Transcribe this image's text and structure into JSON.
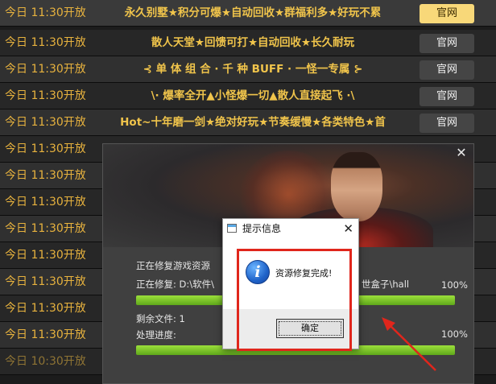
{
  "servers": [
    {
      "time": "今日 11:30开放",
      "desc": "永久别墅★积分可爆★自动回收★群福利多★好玩不累",
      "site": "官网"
    },
    {
      "time": "今日 11:30开放",
      "desc": "散人天堂★回馈可打★自动回收★长久耐玩",
      "site": "官网"
    },
    {
      "time": "今日 11:30开放",
      "desc": "⊰ 单 体 组 合 · 千 种 BUFF · 一怪一专属 ⊱",
      "site": "官网"
    },
    {
      "time": "今日 11:30开放",
      "desc": "\\· 爆率全开▲小怪爆一切▲散人直接起飞 ·\\",
      "site": "官网"
    },
    {
      "time": "今日 11:30开放",
      "desc": "Hot~十年磨一剑★绝对好玩★节奏缓慢★各类特色★首",
      "site": "官网"
    },
    {
      "time": "今日 11:30开放",
      "desc": "",
      "site": ""
    },
    {
      "time": "今日 11:30开放",
      "desc": "",
      "site": ""
    },
    {
      "time": "今日 11:30开放",
      "desc": "",
      "site": ""
    },
    {
      "time": "今日 11:30开放",
      "desc": "",
      "site": ""
    },
    {
      "time": "今日 11:30开放",
      "desc": "",
      "site": ""
    },
    {
      "time": "今日 11:30开放",
      "desc": "",
      "site": ""
    },
    {
      "time": "今日 11:30开放",
      "desc": "",
      "site": ""
    },
    {
      "time": "今日 11:30开放",
      "desc": "",
      "site": ""
    },
    {
      "time": "今日 10:30开放",
      "desc": "",
      "site": ""
    }
  ],
  "repair_window": {
    "close": "✕",
    "status": "正在修复游戏资源",
    "repairing_label": "正在修复: D:\\软件\\",
    "path_tail": "世盒子\\hall",
    "progress1_text": "100%",
    "progress1_value": 1.0,
    "remaining_label": "剩余文件: 1",
    "process_label": "处理进度:",
    "progress2_text": "100%",
    "progress2_value": 1.0
  },
  "dialog": {
    "title": "提示信息",
    "close": "✕",
    "icon": "info-icon",
    "message": "资源修复完成!",
    "ok": "确定"
  },
  "colors": {
    "accent": "#e7b23e",
    "annotation": "#e0261c",
    "progress": "#7cc72a"
  }
}
